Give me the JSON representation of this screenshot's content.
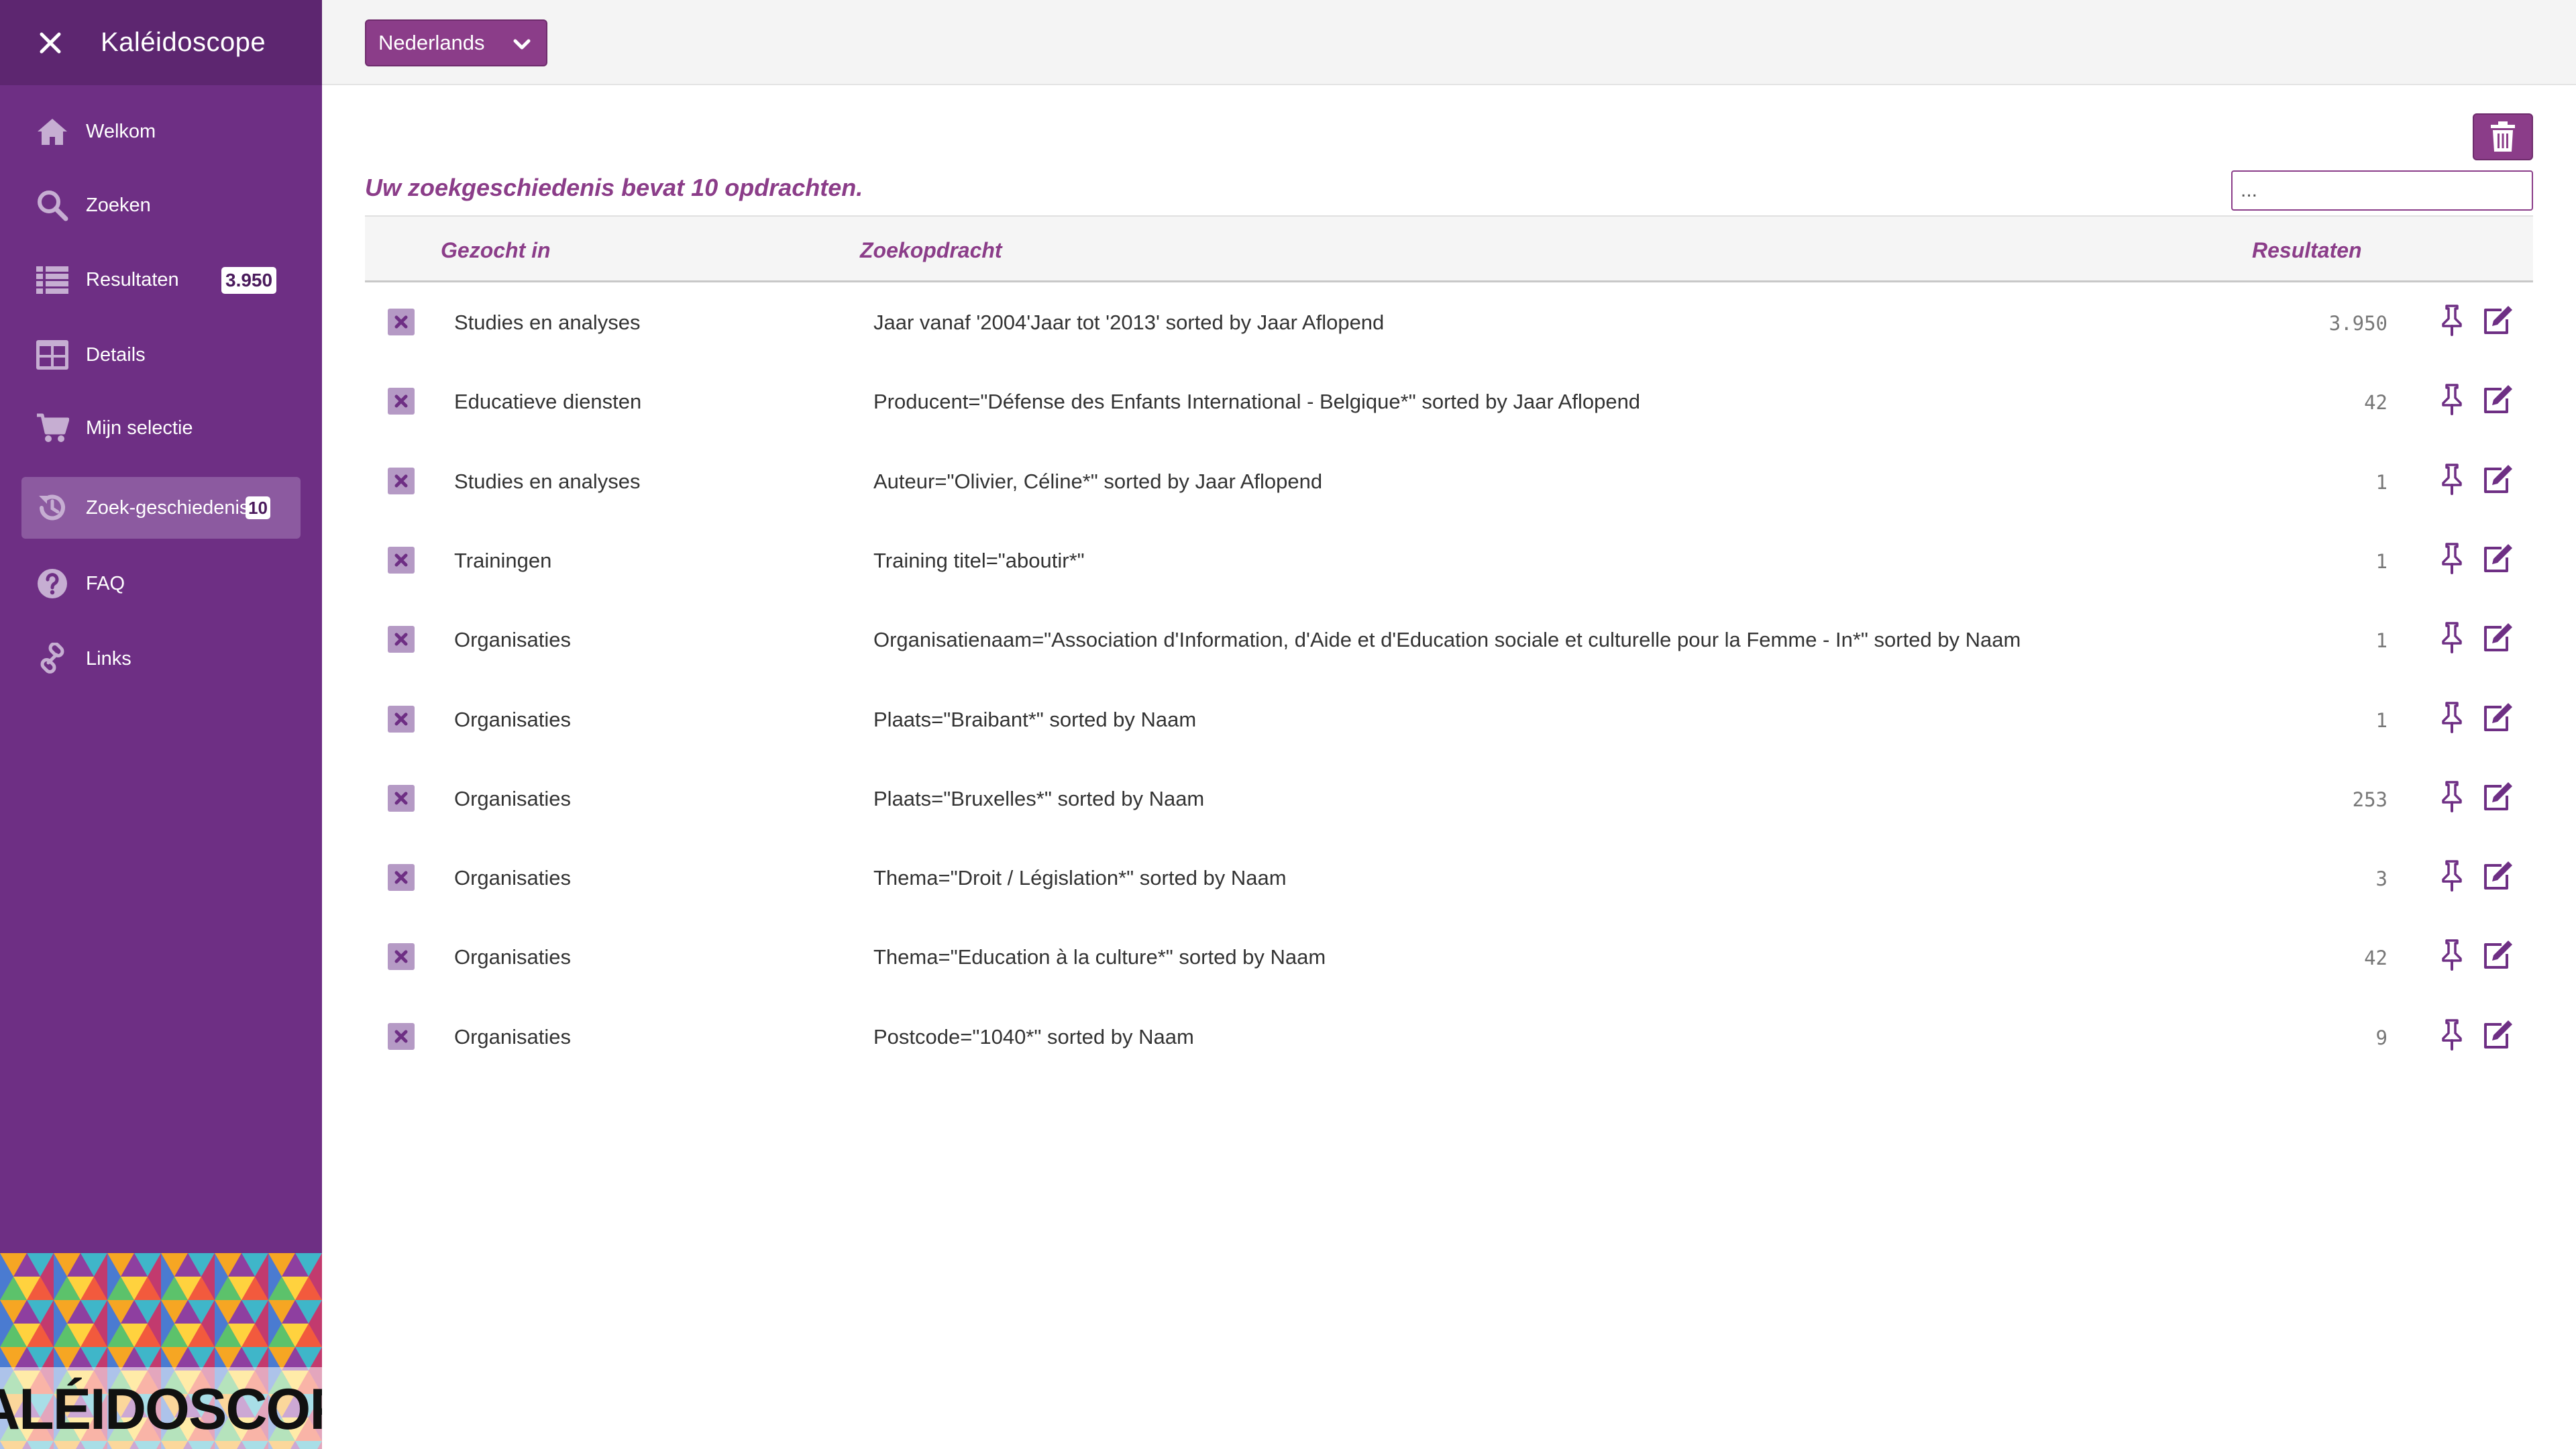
{
  "app": {
    "title": "Kaléidoscope",
    "logo_text": "KALÉIDOSCOPE"
  },
  "sidebar": {
    "items": [
      {
        "label": "Welkom",
        "icon": "home-icon",
        "badge": null,
        "active": false
      },
      {
        "label": "Zoeken",
        "icon": "search-icon",
        "badge": null,
        "active": false
      },
      {
        "label": "Resultaten",
        "icon": "list-icon",
        "badge": "3.950",
        "active": false
      },
      {
        "label": "Details",
        "icon": "grid-icon",
        "badge": null,
        "active": false
      },
      {
        "label": "Mijn selectie",
        "icon": "cart-icon",
        "badge": null,
        "active": false
      },
      {
        "label": "Zoek-geschiedenis",
        "icon": "history-icon",
        "badge": "10",
        "active": true
      },
      {
        "label": "FAQ",
        "icon": "question-icon",
        "badge": null,
        "active": false
      },
      {
        "label": "Links",
        "icon": "link-icon",
        "badge": null,
        "active": false
      }
    ]
  },
  "topbar": {
    "language": "Nederlands"
  },
  "history": {
    "summary": "Uw zoekgeschiedenis bevat 10 opdrachten.",
    "filter_placeholder": "...",
    "columns": {
      "domain": "Gezocht in",
      "query": "Zoekopdracht",
      "results": "Resultaten"
    },
    "rows": [
      {
        "domain": "Studies en analyses",
        "query": "Jaar vanaf '2004'Jaar tot '2013' sorted by Jaar Aflopend",
        "count": "3.950"
      },
      {
        "domain": "Educatieve diensten",
        "query": "Producent=\"Défense des Enfants International - Belgique*\" sorted by Jaar Aflopend",
        "count": "42"
      },
      {
        "domain": "Studies en analyses",
        "query": "Auteur=\"Olivier, Céline*\" sorted by Jaar Aflopend",
        "count": "1"
      },
      {
        "domain": "Trainingen",
        "query": "Training titel=\"aboutir*\"",
        "count": "1"
      },
      {
        "domain": "Organisaties",
        "query": "Organisatienaam=\"Association d'Information, d'Aide et d'Education sociale et culturelle pour la Femme - In*\" sorted by Naam",
        "count": "1"
      },
      {
        "domain": "Organisaties",
        "query": "Plaats=\"Braibant*\" sorted by Naam",
        "count": "1"
      },
      {
        "domain": "Organisaties",
        "query": "Plaats=\"Bruxelles*\" sorted by Naam",
        "count": "253"
      },
      {
        "domain": "Organisaties",
        "query": "Thema=\"Droit / Législation*\" sorted by Naam",
        "count": "3"
      },
      {
        "domain": "Organisaties",
        "query": "Thema=\"Education à la culture*\" sorted by Naam",
        "count": "42"
      },
      {
        "domain": "Organisaties",
        "query": "Postcode=\"1040*\" sorted by Naam",
        "count": "9"
      }
    ]
  },
  "colors": {
    "sidebar": "#6e2f84",
    "sidebar_header": "#5d2670",
    "accent": "#8b3d89",
    "active_item": "#8c5aa0"
  }
}
